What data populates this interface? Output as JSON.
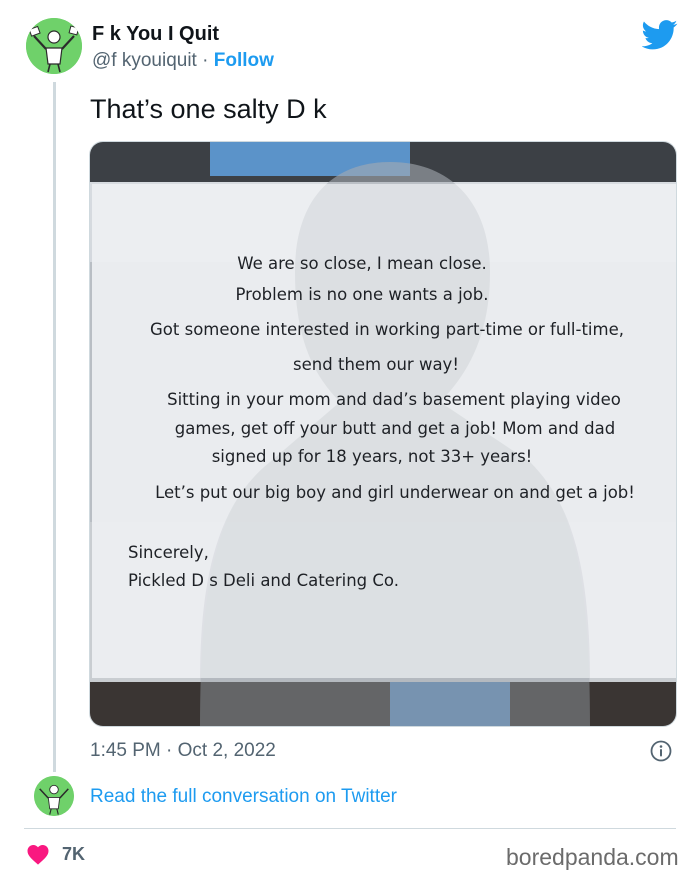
{
  "header": {
    "display_name": "F k You I Quit",
    "handle": "@f kyouiquit",
    "separator": "·",
    "follow_label": "Follow",
    "brand_icon": "twitter-bird-icon",
    "brand_color": "#1d9bf0"
  },
  "tweet": {
    "text": "That’s one salty D k",
    "timestamp": "1:45 PM · Oct 2, 2022"
  },
  "sign": {
    "lines": [
      "We are so close, I mean close.",
      "Problem is no one wants a job.",
      "Got someone interested in working part-time or full-time,",
      "send them our way!",
      "Sitting in your mom and dad’s basement playing video",
      "games, get off your butt and get a job! Mom and dad",
      "signed up for 18 years, not 33+ years!",
      "Let’s put our big boy and girl underwear on and get a job!"
    ],
    "closing": "Sincerely,",
    "signature": "Pickled D s Deli and Catering Co."
  },
  "footer": {
    "read_link": "Read the full conversation on Twitter",
    "likes": "7K",
    "heart_color": "#f91880",
    "watermark": "boredpanda.com"
  }
}
